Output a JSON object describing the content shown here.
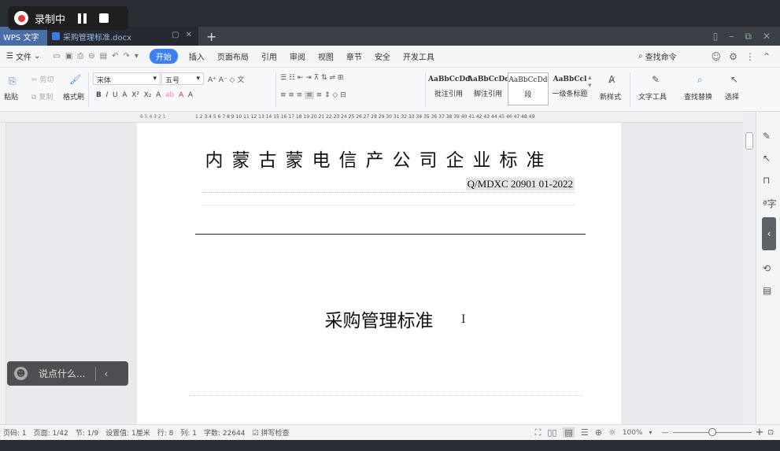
{
  "recorder": {
    "label": "录制中"
  },
  "titlebar": {
    "app_tab": "WPS 文字",
    "doc_tab": "采购管理标准.docx"
  },
  "menu": {
    "file": "文件",
    "items": [
      "开始",
      "插入",
      "页面布局",
      "引用",
      "审阅",
      "视图",
      "章节",
      "安全",
      "开发工具"
    ],
    "active_index": 0,
    "search": "查找命令"
  },
  "ribbon": {
    "paste": "粘贴",
    "cut": "剪切",
    "copy": "复制",
    "format_painter": "格式刷",
    "font_name": "宋体",
    "font_size": "五号",
    "styles": [
      {
        "preview": "AaBbCcDd",
        "name": "批注引用"
      },
      {
        "preview": "AaBbCcDd",
        "name": "脚注引用"
      },
      {
        "preview": "AaBbCcDd",
        "name": "段"
      },
      {
        "preview": "AaBbCcl",
        "name": "一级条标题"
      }
    ],
    "new_style": "新样式",
    "text_tools": "文字工具",
    "find_replace": "查找替换",
    "select": "选择"
  },
  "document": {
    "corp_title": "内蒙古蒙电信产公司企业标准",
    "std_code": "Q/MDXC 20901 01-2022",
    "doc_title": "采购管理标准"
  },
  "chat": {
    "placeholder": "说点什么..."
  },
  "status": {
    "page_num": "页码: 1",
    "pages": "页面: 1/42",
    "section": "节: 1/9",
    "setting": "设置值: 1厘米",
    "row": "行: 8",
    "col": "列: 1",
    "word_count": "字数: 22644",
    "spell_check": "拼写检查",
    "zoom": "100%"
  },
  "colors": {
    "accent": "#3b7ff4",
    "app_tab": "#4a6ea9"
  }
}
